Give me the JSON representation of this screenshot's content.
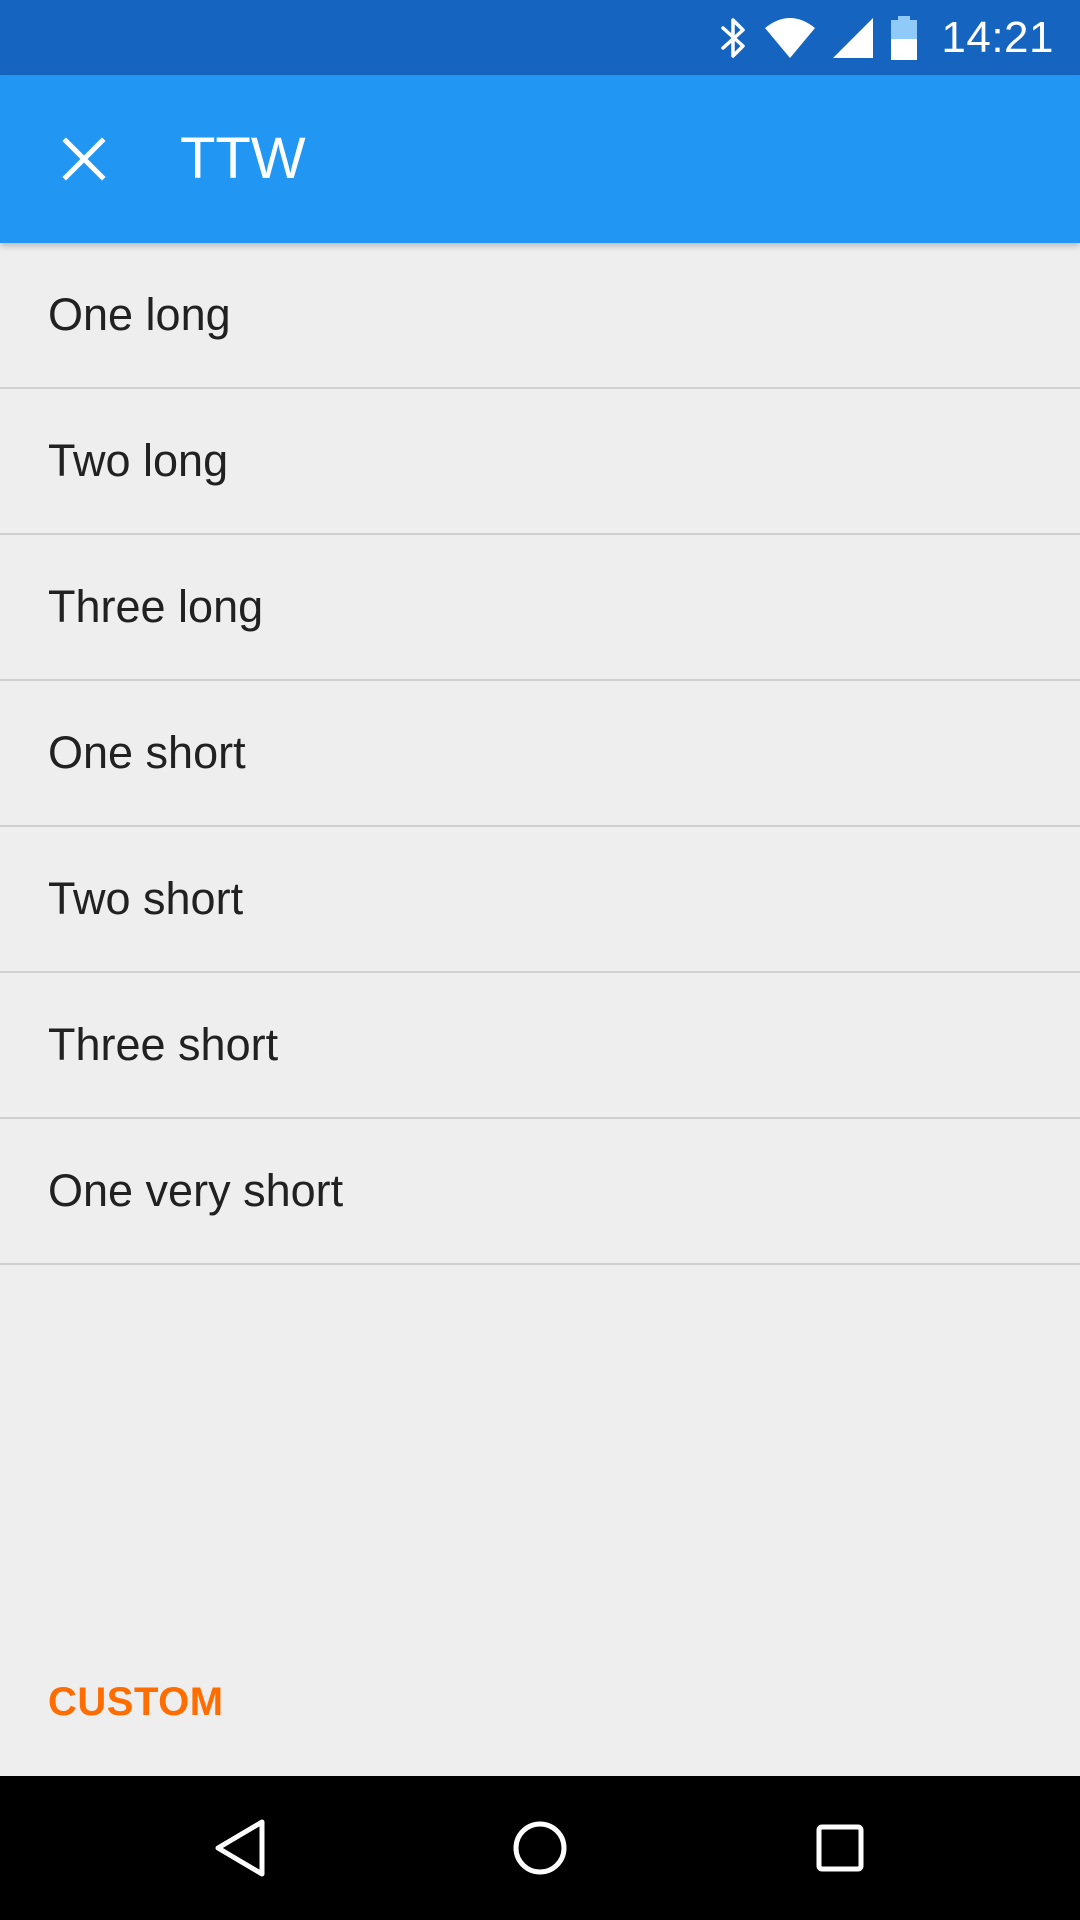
{
  "status_bar": {
    "time": "14:21",
    "icons": [
      "bluetooth-icon",
      "wifi-icon",
      "signal-icon",
      "battery-icon"
    ],
    "background": "#1565c0"
  },
  "app_bar": {
    "title": "TTW",
    "close_icon": "close-icon",
    "background": "#2196f3"
  },
  "list": {
    "items": [
      {
        "label": "One long"
      },
      {
        "label": "Two long"
      },
      {
        "label": "Three long"
      },
      {
        "label": "One short"
      },
      {
        "label": "Two short"
      },
      {
        "label": "Three short"
      },
      {
        "label": "One very short"
      }
    ]
  },
  "custom_button": {
    "label": "CUSTOM",
    "color": "#ff6d00"
  },
  "nav_bar": {
    "icons": [
      "back-icon",
      "home-icon",
      "recents-icon"
    ]
  }
}
